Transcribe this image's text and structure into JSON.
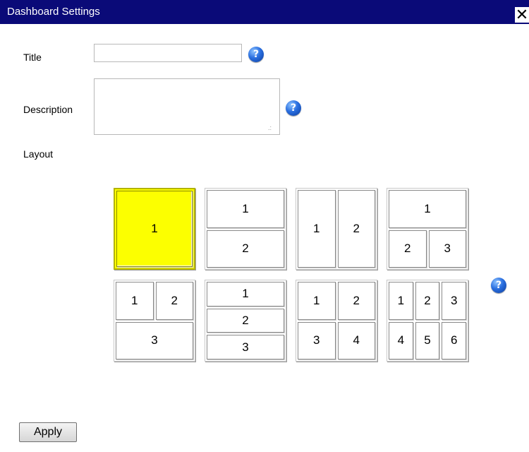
{
  "dialog": {
    "title": "Dashboard Settings",
    "close_glyph": "✕"
  },
  "form": {
    "title_label": "Title",
    "title_value": "",
    "description_label": "Description",
    "description_value": "",
    "layout_label": "Layout",
    "help_glyph": "?"
  },
  "layouts": [
    {
      "rows": [
        [
          "1"
        ]
      ],
      "selected": true
    },
    {
      "rows": [
        [
          "1"
        ],
        [
          "2"
        ]
      ],
      "selected": false
    },
    {
      "rows": [
        [
          "1",
          "2"
        ]
      ],
      "selected": false
    },
    {
      "rows": [
        [
          "1"
        ],
        [
          "2",
          "3"
        ]
      ],
      "selected": false
    },
    {
      "rows": [
        [
          "1",
          "2"
        ],
        [
          "3"
        ]
      ],
      "selected": false
    },
    {
      "rows": [
        [
          "1"
        ],
        [
          "2"
        ],
        [
          "3"
        ]
      ],
      "selected": false
    },
    {
      "rows": [
        [
          "1",
          "2"
        ],
        [
          "3",
          "4"
        ]
      ],
      "selected": false
    },
    {
      "rows": [
        [
          "1",
          "2",
          "3"
        ],
        [
          "4",
          "5",
          "6"
        ]
      ],
      "selected": false
    }
  ],
  "buttons": {
    "apply_label": "Apply"
  },
  "colors": {
    "titlebar": "#0a0a78",
    "selected_layout": "#fcff00"
  },
  "icons": {
    "help": "help-icon",
    "close": "close-icon"
  }
}
